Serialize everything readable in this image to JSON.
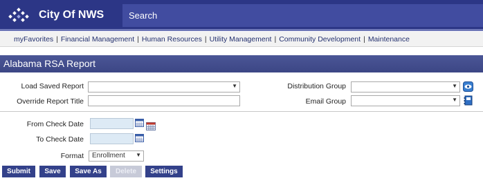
{
  "app": {
    "title": "City Of NWS",
    "search_label": "Search"
  },
  "nav": [
    "myFavorites",
    "Financial Management",
    "Human Resources",
    "Utility Management",
    "Community Development",
    "Maintenance"
  ],
  "report": {
    "title": "Alabama RSA Report"
  },
  "form": {
    "load_saved_report": {
      "label": "Load Saved Report",
      "value": ""
    },
    "override_report_title": {
      "label": "Override Report Title",
      "value": ""
    },
    "distribution_group": {
      "label": "Distribution Group",
      "value": ""
    },
    "email_group": {
      "label": "Email Group",
      "value": ""
    },
    "from_check_date": {
      "label": "From Check Date",
      "value": ""
    },
    "to_check_date": {
      "label": "To Check Date",
      "value": ""
    },
    "format": {
      "label": "Format",
      "value": "Enrollment"
    }
  },
  "buttons": {
    "submit": "Submit",
    "save": "Save",
    "save_as": "Save As",
    "delete": "Delete",
    "settings": "Settings"
  },
  "icons": {
    "logo": "diamond-dots-logo",
    "calendar": "calendar-icon",
    "calendar_grid": "calendar-grid-icon",
    "distribution_group_action": "eye-icon",
    "email_group_action": "address-book-icon"
  },
  "colors": {
    "header_bg": "#2c3686",
    "search_bg": "#414ca0",
    "report_header_bg": "#414b8c",
    "button_bg": "#33418a",
    "button_disabled_bg": "#c7cad8",
    "date_field_bg": "#ddeaf5"
  }
}
